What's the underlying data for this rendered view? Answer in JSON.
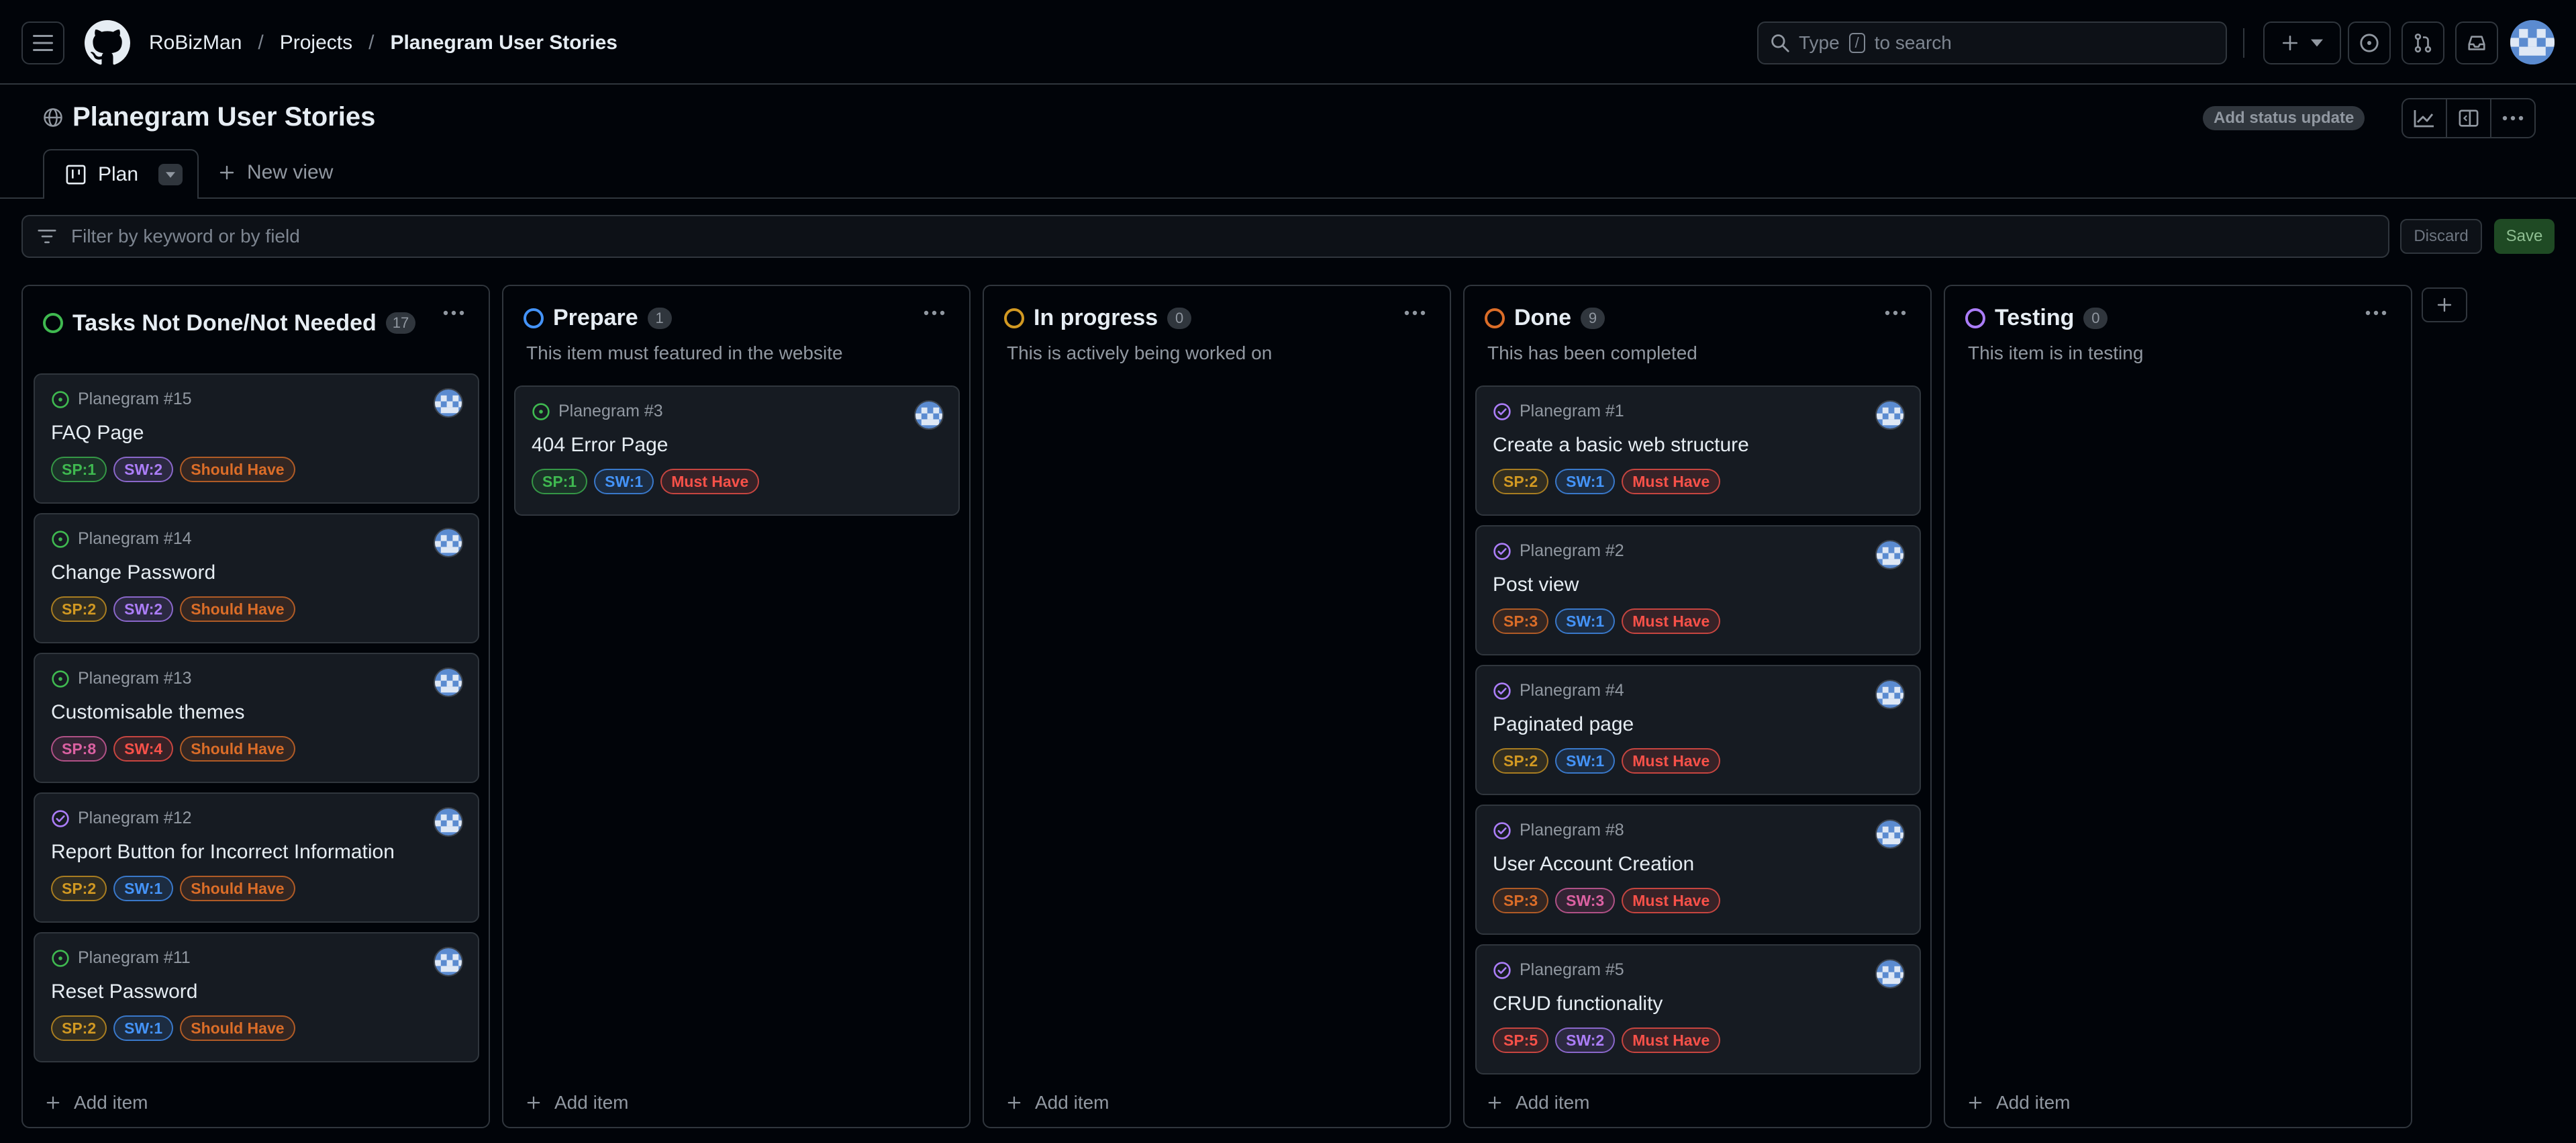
{
  "header": {
    "breadcrumbs": [
      "RoBizMan",
      "Projects",
      "Planegram User Stories"
    ],
    "search_placeholder_before": "Type",
    "search_key": "/",
    "search_placeholder_after": "to search"
  },
  "project": {
    "title": "Planegram User Stories",
    "status_update_label": "Add status update"
  },
  "tabs": {
    "active": "Plan",
    "new_view": "New view"
  },
  "filter": {
    "placeholder": "Filter by keyword or by field",
    "discard": "Discard",
    "save": "Save"
  },
  "colors": {
    "green": "#3fb950",
    "blue": "#4493f8",
    "orange": "#d29922",
    "purple": "#ab7df8",
    "red": "#f85149"
  },
  "columns": [
    {
      "name": "Tasks Not Done/Not Needed",
      "count": "17",
      "description": "",
      "status_color": "#3fb950",
      "add_item": "Add item",
      "cards": [
        {
          "ref": "Planegram #15",
          "title": "FAQ Page",
          "state_icon": "issue-open-icon",
          "labels": [
            {
              "text": "SP:1",
              "color": "#3fb950"
            },
            {
              "text": "SW:2",
              "color": "#ab7df8"
            },
            {
              "text": "Should Have",
              "color": "#db6d28"
            }
          ]
        },
        {
          "ref": "Planegram #14",
          "title": "Change Password",
          "state_icon": "issue-open-icon",
          "labels": [
            {
              "text": "SP:2",
              "color": "#d29922"
            },
            {
              "text": "SW:2",
              "color": "#ab7df8"
            },
            {
              "text": "Should Have",
              "color": "#db6d28"
            }
          ]
        },
        {
          "ref": "Planegram #13",
          "title": "Customisable themes",
          "state_icon": "issue-open-icon",
          "labels": [
            {
              "text": "SP:8",
              "color": "#db61a2"
            },
            {
              "text": "SW:4",
              "color": "#f85149"
            },
            {
              "text": "Should Have",
              "color": "#db6d28"
            }
          ]
        },
        {
          "ref": "Planegram #12",
          "title": "Report Button for Incorrect Information",
          "state_icon": "issue-closed-icon",
          "labels": [
            {
              "text": "SP:2",
              "color": "#d29922"
            },
            {
              "text": "SW:1",
              "color": "#4493f8"
            },
            {
              "text": "Should Have",
              "color": "#db6d28"
            }
          ]
        },
        {
          "ref": "Planegram #11",
          "title": "Reset Password",
          "state_icon": "issue-open-icon",
          "labels": [
            {
              "text": "SP:2",
              "color": "#d29922"
            },
            {
              "text": "SW:1",
              "color": "#4493f8"
            },
            {
              "text": "Should Have",
              "color": "#db6d28"
            }
          ]
        }
      ]
    },
    {
      "name": "Prepare",
      "count": "1",
      "description": "This item must featured in the website",
      "status_color": "#4493f8",
      "add_item": "Add item",
      "cards": [
        {
          "ref": "Planegram #3",
          "title": "404 Error Page",
          "state_icon": "issue-open-icon",
          "labels": [
            {
              "text": "SP:1",
              "color": "#3fb950"
            },
            {
              "text": "SW:1",
              "color": "#4493f8"
            },
            {
              "text": "Must Have",
              "color": "#f85149"
            }
          ]
        }
      ]
    },
    {
      "name": "In progress",
      "count": "0",
      "description": "This is actively being worked on",
      "status_color": "#d29922",
      "add_item": "Add item",
      "cards": []
    },
    {
      "name": "Done",
      "count": "9",
      "description": "This has been completed",
      "status_color": "#db6d28",
      "add_item": "Add item",
      "cards": [
        {
          "ref": "Planegram #1",
          "title": "Create a basic web structure",
          "state_icon": "issue-closed-icon",
          "labels": [
            {
              "text": "SP:2",
              "color": "#d29922"
            },
            {
              "text": "SW:1",
              "color": "#4493f8"
            },
            {
              "text": "Must Have",
              "color": "#f85149"
            }
          ]
        },
        {
          "ref": "Planegram #2",
          "title": "Post view",
          "state_icon": "issue-closed-icon",
          "labels": [
            {
              "text": "SP:3",
              "color": "#db6d28"
            },
            {
              "text": "SW:1",
              "color": "#4493f8"
            },
            {
              "text": "Must Have",
              "color": "#f85149"
            }
          ]
        },
        {
          "ref": "Planegram #4",
          "title": "Paginated page",
          "state_icon": "issue-closed-icon",
          "labels": [
            {
              "text": "SP:2",
              "color": "#d29922"
            },
            {
              "text": "SW:1",
              "color": "#4493f8"
            },
            {
              "text": "Must Have",
              "color": "#f85149"
            }
          ]
        },
        {
          "ref": "Planegram #8",
          "title": "User Account Creation",
          "state_icon": "issue-closed-icon",
          "labels": [
            {
              "text": "SP:3",
              "color": "#db6d28"
            },
            {
              "text": "SW:3",
              "color": "#db61a2"
            },
            {
              "text": "Must Have",
              "color": "#f85149"
            }
          ]
        },
        {
          "ref": "Planegram #5",
          "title": "CRUD functionality",
          "state_icon": "issue-closed-icon",
          "labels": [
            {
              "text": "SP:5",
              "color": "#f85149"
            },
            {
              "text": "SW:2",
              "color": "#ab7df8"
            },
            {
              "text": "Must Have",
              "color": "#f85149"
            }
          ]
        }
      ]
    },
    {
      "name": "Testing",
      "count": "0",
      "description": "This item is in testing",
      "status_color": "#ab7df8",
      "add_item": "Add item",
      "cards": []
    }
  ]
}
